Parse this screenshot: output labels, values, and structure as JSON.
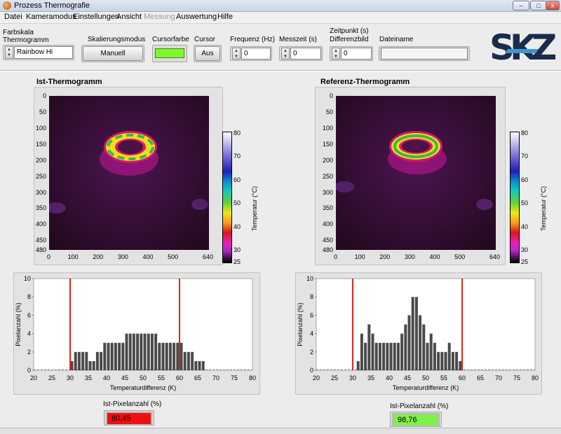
{
  "window": {
    "title": "Prozess Thermografie",
    "min": "–",
    "max": "□",
    "close": "x"
  },
  "menu": [
    "Datei",
    "Kameramodus",
    "Einstellungen",
    "Ansicht",
    "Messung",
    "Auswertung",
    "Hilfe"
  ],
  "menu_disabled": [
    "Messung"
  ],
  "toolbar": {
    "farbskala_label_1": "Farbskala",
    "farbskala_label_2": "Thermogramm",
    "farbskala_value": "Rainbow Hi",
    "skalierung_label": "Skalierungsmodus",
    "skalierung_button": "Manuell",
    "cursorfarbe_label": "Cursorfarbe",
    "cursorfarbe_color": "#7dfa2c",
    "cursor_label": "Cursor",
    "cursor_button": "Aus",
    "frequenz_label": "Frequenz (Hz)",
    "frequenz_value": "0",
    "messzeit_label": "Messzeit (s)",
    "messzeit_value": "0",
    "zeitpunkt_label_1": "Zeitpunkt (s)",
    "zeitpunkt_label_2": "Differenzbild",
    "zeitpunkt_value": "0",
    "dateiname_label": "Dateiname",
    "dateiname_value": ""
  },
  "logo": {
    "letters": [
      "S",
      "K",
      "Z"
    ],
    "accent": "#3f95d0",
    "color": "#1a2b4c"
  },
  "thermograms": [
    {
      "title": "Ist-Thermogramm",
      "y_ticks": [
        "0",
        "50",
        "100",
        "150",
        "200",
        "250",
        "300",
        "350",
        "400",
        "450",
        "480"
      ],
      "x_ticks": [
        "0",
        "100",
        "200",
        "300",
        "400",
        "500",
        "640"
      ],
      "colorbar_ticks": [
        "80",
        "70",
        "60",
        "50",
        "40",
        "30",
        "25"
      ],
      "colorbar_label": "Temperatur (°C)"
    },
    {
      "title": "Referenz-Thermogramm",
      "y_ticks": [
        "0",
        "50",
        "100",
        "150",
        "200",
        "250",
        "300",
        "350",
        "400",
        "450",
        "480"
      ],
      "x_ticks": [
        "0",
        "100",
        "200",
        "300",
        "400",
        "500",
        "640"
      ],
      "colorbar_ticks": [
        "80",
        "70",
        "60",
        "50",
        "40",
        "30",
        "25"
      ],
      "colorbar_label": "Temperatur (°C)"
    }
  ],
  "histograms": [
    {
      "ylabel": "Pixelanzahl (%)",
      "xlabel": "Temperaturdifferenz (K)",
      "y_ticks": [
        "10",
        "8",
        "6",
        "4",
        "2",
        "0"
      ],
      "x_ticks": [
        "20",
        "25",
        "30",
        "35",
        "40",
        "45",
        "50",
        "55",
        "60",
        "65",
        "70",
        "75",
        "80"
      ],
      "indicator_label": "Ist-Pixelanzahl (%)",
      "indicator_value": "80,45",
      "indicator_color": "#ee0f0f"
    },
    {
      "ylabel": "Pixelanzahl (%)",
      "xlabel": "Temperaturdifferenz (K)",
      "y_ticks": [
        "10",
        "8",
        "6",
        "4",
        "2",
        "0"
      ],
      "x_ticks": [
        "20",
        "25",
        "30",
        "35",
        "40",
        "45",
        "50",
        "55",
        "60",
        "65",
        "70",
        "75",
        "80"
      ],
      "indicator_label": "Ist-Pixelanzahl (%)",
      "indicator_value": "98,76",
      "indicator_color": "#7ff04a"
    }
  ],
  "chart_data": [
    {
      "type": "bar",
      "xlabel": "Temperaturdifferenz (K)",
      "ylabel": "Pixelanzahl (%)",
      "xlim": [
        20,
        80
      ],
      "ylim": [
        0,
        10
      ],
      "limits": [
        30,
        60
      ],
      "bin_width": 1,
      "x": [
        30,
        31,
        32,
        33,
        34,
        35,
        36,
        37,
        38,
        39,
        40,
        41,
        42,
        43,
        44,
        45,
        46,
        47,
        48,
        49,
        50,
        51,
        52,
        53,
        54,
        55,
        56,
        57,
        58,
        59,
        60,
        61,
        62,
        63,
        64,
        65,
        66
      ],
      "values": [
        1,
        2,
        2,
        2,
        2,
        1,
        1,
        2,
        2,
        3,
        3,
        3,
        3,
        3,
        3,
        4,
        4,
        4,
        4,
        4,
        4,
        4,
        4,
        4,
        3,
        3,
        3,
        3,
        3,
        3,
        3,
        2,
        2,
        2,
        1,
        1,
        1
      ]
    },
    {
      "type": "bar",
      "xlabel": "Temperaturdifferenz (K)",
      "ylabel": "Pixelanzahl (%)",
      "xlim": [
        20,
        80
      ],
      "ylim": [
        0,
        10
      ],
      "limits": [
        30,
        60
      ],
      "bin_width": 1,
      "x": [
        31,
        32,
        33,
        34,
        35,
        36,
        37,
        38,
        39,
        40,
        41,
        42,
        43,
        44,
        45,
        46,
        47,
        48,
        49,
        50,
        51,
        52,
        53,
        54,
        55,
        56,
        57,
        58,
        59
      ],
      "values": [
        1,
        4,
        3,
        5,
        4,
        3,
        3,
        3,
        3,
        3,
        3,
        3,
        4,
        5,
        6,
        8,
        8,
        6,
        5,
        3,
        4,
        3,
        2,
        2,
        2,
        3,
        2,
        2,
        1
      ]
    }
  ]
}
